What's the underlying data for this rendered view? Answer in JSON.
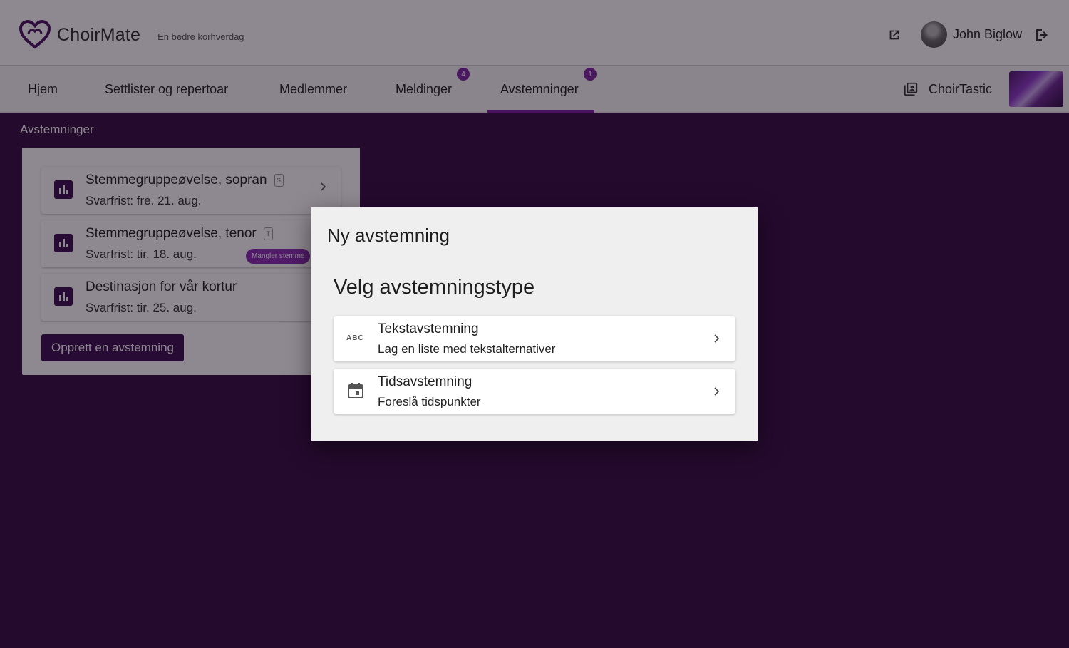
{
  "header": {
    "brand_name": "ChoirMate",
    "tagline": "En bedre korhverdag",
    "user_name": "John Biglow"
  },
  "nav": {
    "tabs": [
      {
        "label": "Hjem"
      },
      {
        "label": "Settlister og repertoar"
      },
      {
        "label": "Medlemmer"
      },
      {
        "label": "Meldinger",
        "badge": "4"
      },
      {
        "label": "Avstemninger",
        "badge": "1",
        "active": true
      }
    ],
    "choir_name": "ChoirTastic"
  },
  "polls": {
    "section_title": "Avstemninger",
    "items": [
      {
        "title": "Stemmegruppeøvelse, sopran",
        "voice_tag": "S",
        "deadline": "Svarfrist: fre. 21. aug."
      },
      {
        "title": "Stemmegruppeøvelse, tenor",
        "voice_tag": "T",
        "deadline": "Svarfrist: tir. 18. aug.",
        "chip": "Mangler stemme"
      },
      {
        "title": "Destinasjon for vår kortur",
        "deadline": "Svarfrist: tir. 25. aug."
      }
    ],
    "create_label": "Opprett en avstemning"
  },
  "dialog": {
    "title": "Ny avstemning",
    "subtitle": "Velg avstemningstype",
    "options": [
      {
        "title": "Tekstavstemning",
        "description": "Lag en liste med tekstalternativer",
        "icon": "abc-icon",
        "icon_text": "ABC"
      },
      {
        "title": "Tidsavstemning",
        "description": "Foreslå tidspunkter",
        "icon": "calendar-icon"
      }
    ]
  },
  "colors": {
    "brand_purple": "#7b1fa2",
    "dark_purple": "#3a1050",
    "background": "#340e42"
  }
}
